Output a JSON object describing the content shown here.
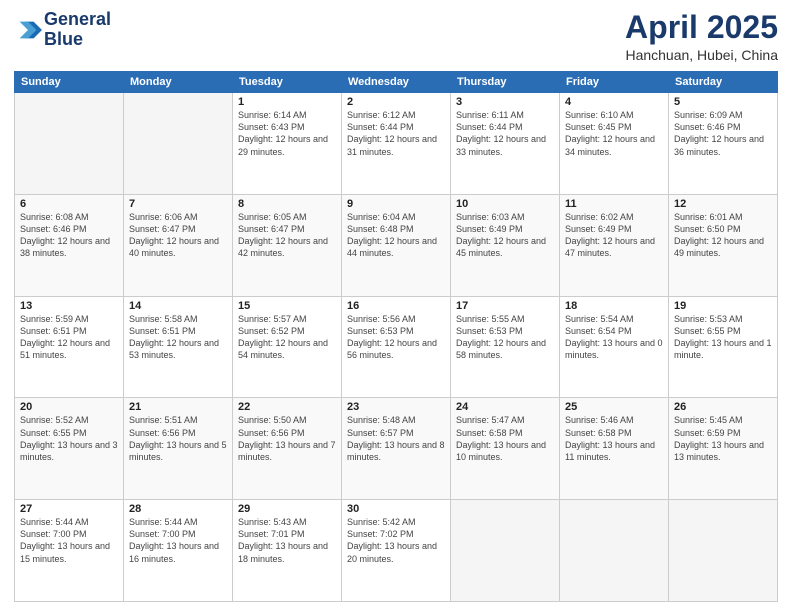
{
  "header": {
    "logo_line1": "General",
    "logo_line2": "Blue",
    "month": "April 2025",
    "location": "Hanchuan, Hubei, China"
  },
  "weekdays": [
    "Sunday",
    "Monday",
    "Tuesday",
    "Wednesday",
    "Thursday",
    "Friday",
    "Saturday"
  ],
  "weeks": [
    [
      {
        "day": "",
        "info": ""
      },
      {
        "day": "",
        "info": ""
      },
      {
        "day": "1",
        "info": "Sunrise: 6:14 AM\nSunset: 6:43 PM\nDaylight: 12 hours and 29 minutes."
      },
      {
        "day": "2",
        "info": "Sunrise: 6:12 AM\nSunset: 6:44 PM\nDaylight: 12 hours and 31 minutes."
      },
      {
        "day": "3",
        "info": "Sunrise: 6:11 AM\nSunset: 6:44 PM\nDaylight: 12 hours and 33 minutes."
      },
      {
        "day": "4",
        "info": "Sunrise: 6:10 AM\nSunset: 6:45 PM\nDaylight: 12 hours and 34 minutes."
      },
      {
        "day": "5",
        "info": "Sunrise: 6:09 AM\nSunset: 6:46 PM\nDaylight: 12 hours and 36 minutes."
      }
    ],
    [
      {
        "day": "6",
        "info": "Sunrise: 6:08 AM\nSunset: 6:46 PM\nDaylight: 12 hours and 38 minutes."
      },
      {
        "day": "7",
        "info": "Sunrise: 6:06 AM\nSunset: 6:47 PM\nDaylight: 12 hours and 40 minutes."
      },
      {
        "day": "8",
        "info": "Sunrise: 6:05 AM\nSunset: 6:47 PM\nDaylight: 12 hours and 42 minutes."
      },
      {
        "day": "9",
        "info": "Sunrise: 6:04 AM\nSunset: 6:48 PM\nDaylight: 12 hours and 44 minutes."
      },
      {
        "day": "10",
        "info": "Sunrise: 6:03 AM\nSunset: 6:49 PM\nDaylight: 12 hours and 45 minutes."
      },
      {
        "day": "11",
        "info": "Sunrise: 6:02 AM\nSunset: 6:49 PM\nDaylight: 12 hours and 47 minutes."
      },
      {
        "day": "12",
        "info": "Sunrise: 6:01 AM\nSunset: 6:50 PM\nDaylight: 12 hours and 49 minutes."
      }
    ],
    [
      {
        "day": "13",
        "info": "Sunrise: 5:59 AM\nSunset: 6:51 PM\nDaylight: 12 hours and 51 minutes."
      },
      {
        "day": "14",
        "info": "Sunrise: 5:58 AM\nSunset: 6:51 PM\nDaylight: 12 hours and 53 minutes."
      },
      {
        "day": "15",
        "info": "Sunrise: 5:57 AM\nSunset: 6:52 PM\nDaylight: 12 hours and 54 minutes."
      },
      {
        "day": "16",
        "info": "Sunrise: 5:56 AM\nSunset: 6:53 PM\nDaylight: 12 hours and 56 minutes."
      },
      {
        "day": "17",
        "info": "Sunrise: 5:55 AM\nSunset: 6:53 PM\nDaylight: 12 hours and 58 minutes."
      },
      {
        "day": "18",
        "info": "Sunrise: 5:54 AM\nSunset: 6:54 PM\nDaylight: 13 hours and 0 minutes."
      },
      {
        "day": "19",
        "info": "Sunrise: 5:53 AM\nSunset: 6:55 PM\nDaylight: 13 hours and 1 minute."
      }
    ],
    [
      {
        "day": "20",
        "info": "Sunrise: 5:52 AM\nSunset: 6:55 PM\nDaylight: 13 hours and 3 minutes."
      },
      {
        "day": "21",
        "info": "Sunrise: 5:51 AM\nSunset: 6:56 PM\nDaylight: 13 hours and 5 minutes."
      },
      {
        "day": "22",
        "info": "Sunrise: 5:50 AM\nSunset: 6:56 PM\nDaylight: 13 hours and 7 minutes."
      },
      {
        "day": "23",
        "info": "Sunrise: 5:48 AM\nSunset: 6:57 PM\nDaylight: 13 hours and 8 minutes."
      },
      {
        "day": "24",
        "info": "Sunrise: 5:47 AM\nSunset: 6:58 PM\nDaylight: 13 hours and 10 minutes."
      },
      {
        "day": "25",
        "info": "Sunrise: 5:46 AM\nSunset: 6:58 PM\nDaylight: 13 hours and 11 minutes."
      },
      {
        "day": "26",
        "info": "Sunrise: 5:45 AM\nSunset: 6:59 PM\nDaylight: 13 hours and 13 minutes."
      }
    ],
    [
      {
        "day": "27",
        "info": "Sunrise: 5:44 AM\nSunset: 7:00 PM\nDaylight: 13 hours and 15 minutes."
      },
      {
        "day": "28",
        "info": "Sunrise: 5:44 AM\nSunset: 7:00 PM\nDaylight: 13 hours and 16 minutes."
      },
      {
        "day": "29",
        "info": "Sunrise: 5:43 AM\nSunset: 7:01 PM\nDaylight: 13 hours and 18 minutes."
      },
      {
        "day": "30",
        "info": "Sunrise: 5:42 AM\nSunset: 7:02 PM\nDaylight: 13 hours and 20 minutes."
      },
      {
        "day": "",
        "info": ""
      },
      {
        "day": "",
        "info": ""
      },
      {
        "day": "",
        "info": ""
      }
    ]
  ]
}
